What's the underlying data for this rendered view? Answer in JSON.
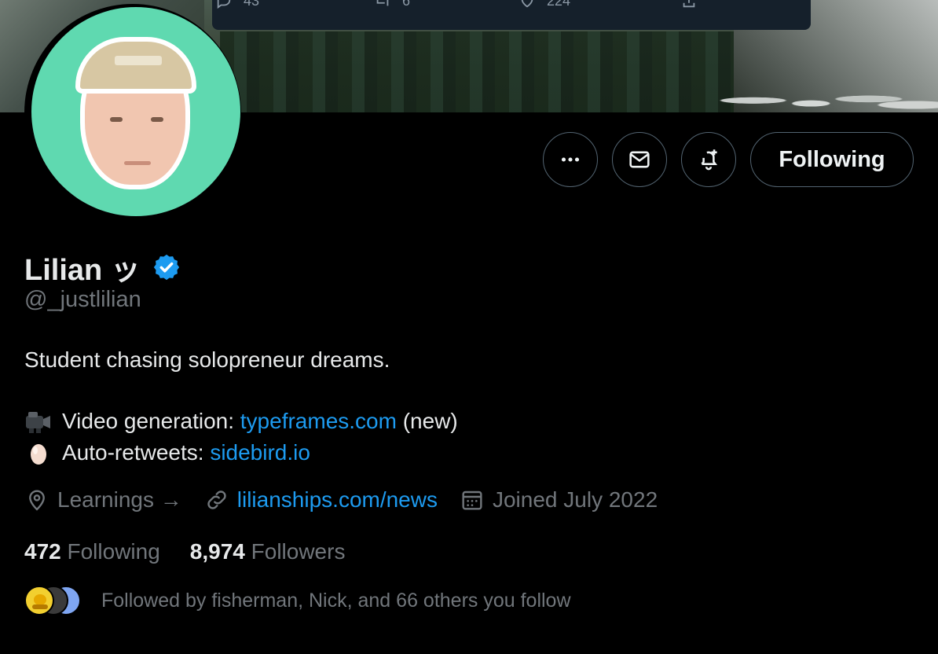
{
  "tweet_bar": {
    "replies": "43",
    "retweets": "6",
    "likes": "224"
  },
  "actions": {
    "more_icon": "ellipsis-icon",
    "message_icon": "envelope-icon",
    "notify_icon": "bell-plus-icon",
    "follow_label": "Following"
  },
  "profile": {
    "name": "Lilian ッ",
    "handle": "@_justlilian",
    "bio_text": "Student chasing solopreneur dreams.",
    "bio_lines": [
      {
        "emoji": "video-camera",
        "prefix": "Video generation: ",
        "link": "typeframes.com",
        "suffix": " (new)"
      },
      {
        "emoji": "egg",
        "prefix": "Auto-retweets: ",
        "link": "sidebird.io",
        "suffix": ""
      }
    ],
    "location": "Learnings →",
    "website": "lilianships.com/news",
    "joined": "Joined July 2022"
  },
  "stats": {
    "following_count": "472",
    "following_label": "Following",
    "followers_count": "8,974",
    "followers_label": "Followers"
  },
  "followed_by": "Followed by fisherman, Nick, and 66 others you follow",
  "colors": {
    "background": "#000000",
    "accent": "#1d9bf0",
    "muted": "#71767b",
    "avatar_bg": "#5fd9b0",
    "verified": "#1d9bf0"
  }
}
